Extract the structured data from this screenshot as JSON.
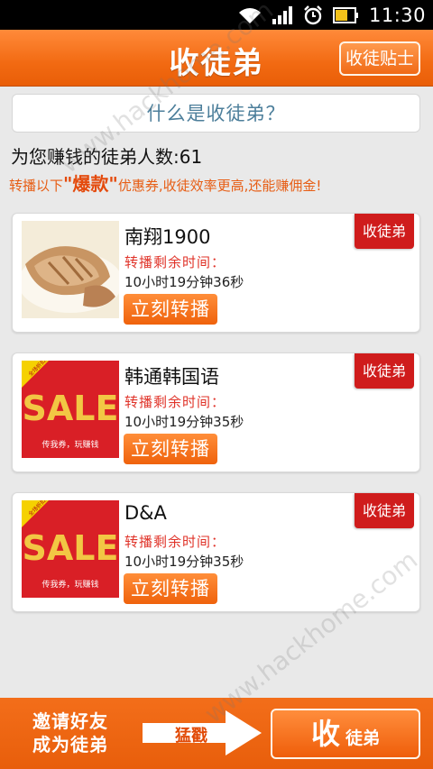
{
  "status_bar": {
    "time": "11:30",
    "icons": [
      "wifi-icon",
      "signal-icon",
      "alarm-icon",
      "battery-icon"
    ]
  },
  "header": {
    "title": "收徒弟",
    "tips_button": "收徒贴士"
  },
  "what_is": {
    "label": "什么是收徒弟？"
  },
  "stats": {
    "count_text": "为您赚钱的徒弟人数:61"
  },
  "promo": {
    "prefix": "转播以下",
    "highlight": "\"爆款\"",
    "suffix": "优惠券,收徒效率更高,还能赚佣金!"
  },
  "cards": [
    {
      "name": "南翔1900",
      "remain_label": "转播剩余时间：",
      "remain_time": "10小时19分钟36秒",
      "share_button": "立刻转播",
      "tag": "收徒弟",
      "image": "food-photo"
    },
    {
      "name": "韩通韩国语",
      "remain_label": "转播剩余时间：",
      "remain_time": "10小时19分钟35秒",
      "share_button": "立刻转播",
      "tag": "收徒弟",
      "image": "sale-poster",
      "poster_text": "SALE",
      "poster_sub": "传我券，玩赚钱",
      "poster_badge": "全场折扣券"
    },
    {
      "name": "D&A",
      "remain_label": "转播剩余时间：",
      "remain_time": "10小时19分钟35秒",
      "share_button": "立刻转播",
      "tag": "收徒弟",
      "image": "sale-poster",
      "poster_text": "SALE",
      "poster_sub": "传我券，玩赚钱",
      "poster_badge": "全场折扣券"
    }
  ],
  "bottom_bar": {
    "invite_line1": "邀请好友",
    "invite_line2": "成为徒弟",
    "arrow_text": "猛戳",
    "recruit_big": "收",
    "recruit_small": "徒弟"
  },
  "watermark": "www.hackhome.com",
  "colors": {
    "accent": "#f26a12",
    "tag_red": "#cf1c1c",
    "link_blue": "#4d7f9b"
  }
}
